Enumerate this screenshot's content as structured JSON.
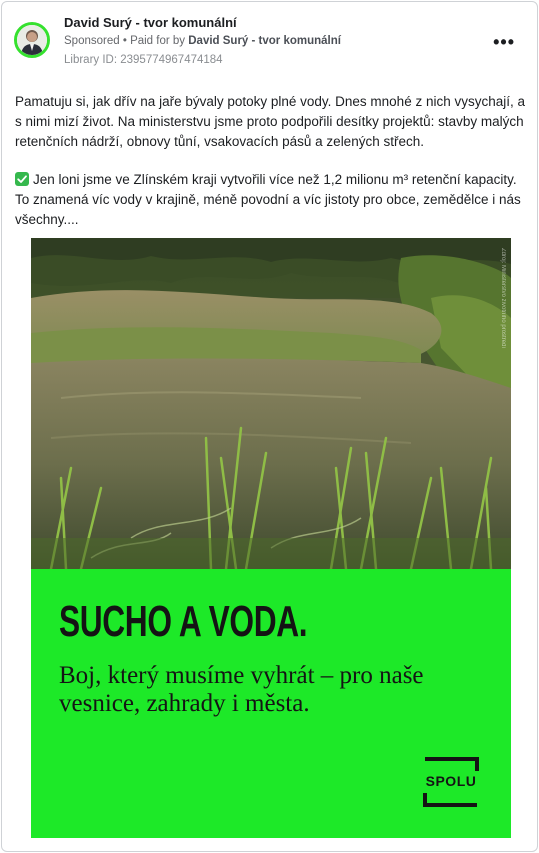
{
  "post": {
    "page_name": "David Surý - tvor komunální",
    "sponsored_label": "Sponsored",
    "paid_for_prefix": "Paid for by",
    "paid_for_name": "David Surý - tvor komunální",
    "library_id": "Library ID: 2395774967474184",
    "more_icon": "more-horizontal-icon",
    "paragraph_1": "Pamatuju si, jak dřív na jaře bývaly potoky plné vody. Dnes mnohé z nich vysychají, a s nimi mizí život. Na ministerstvu jsme proto podpořili desítky projektů: stavby malých retenčních nádrží, obnovy tůní, vsakovacích pásů a zelených střech.",
    "paragraph_2": "Jen loni jsme ve Zlínském kraji vytvořili více než 1,2 milionu m³ retenční kapacity. To znamená víc vody v krajině, méně povodní a víc jistoty pro obce, zemědělce i nás všechny....",
    "check_icon": "check-box-icon"
  },
  "creative": {
    "headline": "SUCHO A VODA.",
    "subline": "Boj, který musíme vyhrát – pro naše vesnice, zahrady i města.",
    "logo_text": "SPOLU",
    "panel_color": "#1de928",
    "photo_credit": "Zdroj: Ministerstvo životního prostředí"
  },
  "colors": {
    "avatar_ring": "#35e12e",
    "text_primary": "#1c1e21",
    "text_secondary": "#65676b"
  }
}
